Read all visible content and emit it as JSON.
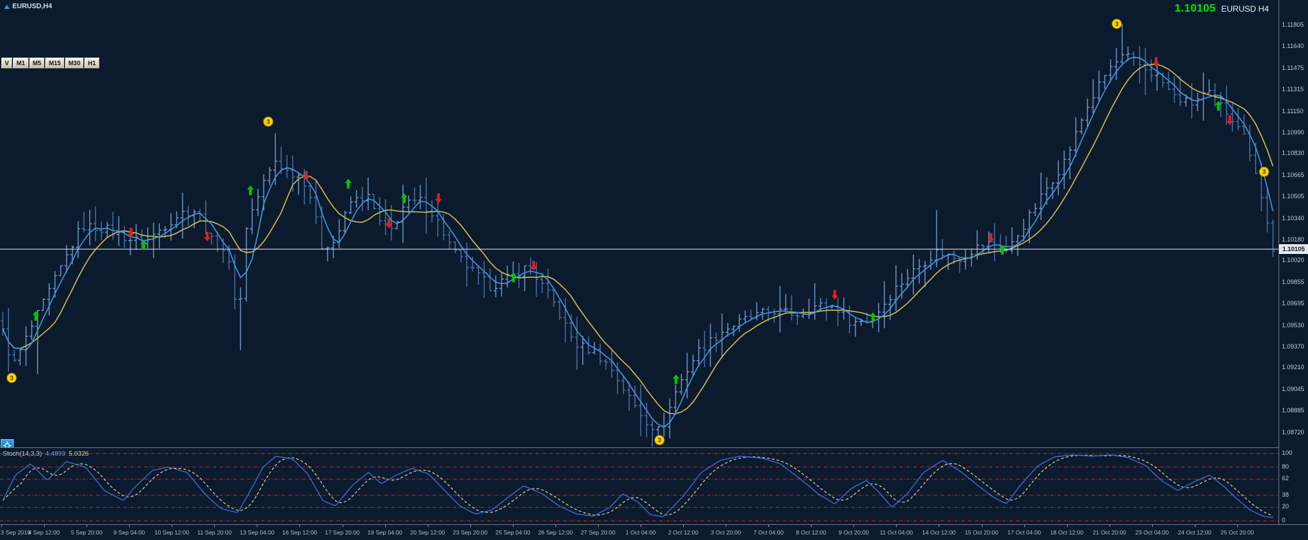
{
  "window": {
    "symbol_label": "EURUSD,H4",
    "quote": "1.10105",
    "quote_symbol": "EURUSD H4"
  },
  "toolbar": {
    "buttons": [
      "V",
      "M1",
      "M5",
      "M15",
      "M30",
      "H1"
    ]
  },
  "price_scale": {
    "current_price": "1.10105"
  },
  "colors": {
    "background": "#0b1a2c",
    "bar_up": "#6f97cf",
    "bar_down": "#4a72ab",
    "ma_fast": "#3f96e0",
    "ma_slow": "#cdb94f",
    "buy_arrow": "#00c800",
    "sell_arrow": "#e01f1f",
    "marker_fill": "#ffd400",
    "marker_stroke": "#8a6d00",
    "quote_green": "#00e600",
    "price_line": "#e6e9ee",
    "stoch_main": "#4066c8",
    "stoch_signal": "#d8d0ae",
    "level_red": "#b03030",
    "axis_text": "#b6bcc6"
  },
  "chart_data": [
    {
      "name": "price-chart",
      "type": "ohlc",
      "symbol": "EURUSD",
      "timeframe": "H4",
      "title": "EURUSD H4",
      "current_price": 1.10105,
      "price_range": {
        "max": 1.1199,
        "min": 1.0861
      },
      "bars_count": 220,
      "y_ticks": [
        "1.11805",
        "1.11640",
        "1.11475",
        "1.11315",
        "1.11150",
        "1.10990",
        "1.10830",
        "1.10665",
        "1.10505",
        "1.10340",
        "1.10180",
        "1.10020",
        "1.09855",
        "1.09695",
        "1.09530",
        "1.09370",
        "1.09210",
        "1.09045",
        "1.08885",
        "1.08720"
      ],
      "x_labels": [
        "3 Sep 2019",
        "4 Sep 12:00",
        "5 Sep 20:00",
        "9 Sep 04:00",
        "10 Sep 12:00",
        "11 Sep 20:00",
        "13 Sep 04:00",
        "16 Sep 12:00",
        "17 Sep 20:00",
        "19 Sep 04:00",
        "20 Sep 12:00",
        "23 Sep 20:00",
        "25 Sep 04:00",
        "26 Sep 12:00",
        "27 Sep 20:00",
        "1 Oct 04:00",
        "2 Oct 12:00",
        "3 Oct 20:00",
        "7 Oct 04:00",
        "8 Oct 12:00",
        "9 Oct 20:00",
        "11 Oct 04:00",
        "14 Oct 12:00",
        "15 Oct 20:00",
        "17 Oct 04:00",
        "18 Oct 12:00",
        "21 Oct 20:00",
        "23 Oct 04:00",
        "24 Oct 12:00",
        "25 Oct 20:00"
      ],
      "close_path": [
        [
          0.0,
          1.0948
        ],
        [
          0.008,
          1.0922
        ],
        [
          0.026,
          1.0958
        ],
        [
          0.062,
          1.1028
        ],
        [
          0.081,
          1.1026
        ],
        [
          0.1,
          1.1018
        ],
        [
          0.112,
          1.1016
        ],
        [
          0.14,
          1.1038
        ],
        [
          0.153,
          1.104
        ],
        [
          0.164,
          1.1017
        ],
        [
          0.176,
          1.1009
        ],
        [
          0.186,
          1.0958
        ],
        [
          0.192,
          1.103
        ],
        [
          0.206,
          1.1062
        ],
        [
          0.215,
          1.1078
        ],
        [
          0.222,
          1.107
        ],
        [
          0.235,
          1.1066
        ],
        [
          0.241,
          1.1055
        ],
        [
          0.251,
          1.1013
        ],
        [
          0.261,
          1.1016
        ],
        [
          0.274,
          1.1046
        ],
        [
          0.287,
          1.1051
        ],
        [
          0.298,
          1.1028
        ],
        [
          0.306,
          1.1025
        ],
        [
          0.316,
          1.1044
        ],
        [
          0.329,
          1.1047
        ],
        [
          0.34,
          1.1036
        ],
        [
          0.355,
          1.1008
        ],
        [
          0.368,
          1.0995
        ],
        [
          0.384,
          1.0982
        ],
        [
          0.401,
          1.099
        ],
        [
          0.414,
          1.0998
        ],
        [
          0.433,
          1.0971
        ],
        [
          0.45,
          1.0939
        ],
        [
          0.466,
          1.0933
        ],
        [
          0.479,
          1.092
        ],
        [
          0.495,
          1.0895
        ],
        [
          0.508,
          1.0879
        ],
        [
          0.518,
          1.0872
        ],
        [
          0.531,
          1.0906
        ],
        [
          0.547,
          1.0933
        ],
        [
          0.567,
          1.0949
        ],
        [
          0.586,
          1.0958
        ],
        [
          0.606,
          1.0964
        ],
        [
          0.625,
          1.0961
        ],
        [
          0.641,
          1.0968
        ],
        [
          0.656,
          1.0967
        ],
        [
          0.668,
          1.0955
        ],
        [
          0.684,
          1.0957
        ],
        [
          0.703,
          1.0981
        ],
        [
          0.72,
          1.0997
        ],
        [
          0.736,
          1.1009
        ],
        [
          0.752,
          1.1003
        ],
        [
          0.769,
          1.1013
        ],
        [
          0.779,
          1.1015
        ],
        [
          0.791,
          1.1009
        ],
        [
          0.808,
          1.1035
        ],
        [
          0.824,
          1.106
        ],
        [
          0.837,
          1.1079
        ],
        [
          0.853,
          1.1117
        ],
        [
          0.87,
          1.1146
        ],
        [
          0.883,
          1.1157
        ],
        [
          0.896,
          1.1149
        ],
        [
          0.909,
          1.1141
        ],
        [
          0.922,
          1.1126
        ],
        [
          0.935,
          1.112
        ],
        [
          0.948,
          1.1129
        ],
        [
          0.961,
          1.1117
        ],
        [
          0.974,
          1.1104
        ],
        [
          0.985,
          1.1076
        ],
        [
          0.993,
          1.104
        ],
        [
          1.0,
          1.10105
        ]
      ],
      "wick_events": [
        {
          "f": 0.026,
          "low": 1.0916
        },
        {
          "f": 0.186,
          "low": 1.0934
        },
        {
          "f": 0.215,
          "high": 1.1098
        },
        {
          "f": 0.518,
          "low": 1.0867
        },
        {
          "f": 0.736,
          "high": 1.104
        },
        {
          "f": 0.883,
          "high": 1.1181
        }
      ],
      "ma_fast_period": 4,
      "ma_slow_period": 9,
      "signals": {
        "buy": [
          [
            0.026,
            1.096
          ],
          [
            0.111,
            1.1014
          ],
          [
            0.195,
            1.1055
          ],
          [
            0.272,
            1.106
          ],
          [
            0.316,
            1.1049
          ],
          [
            0.402,
            1.0989
          ],
          [
            0.53,
            1.0912
          ],
          [
            0.685,
            1.0959
          ],
          [
            0.787,
            1.101
          ],
          [
            0.957,
            1.1119
          ]
        ],
        "sell": [
          [
            0.101,
            1.1023
          ],
          [
            0.161,
            1.102
          ],
          [
            0.239,
            1.1066
          ],
          [
            0.304,
            1.103
          ],
          [
            0.343,
            1.1049
          ],
          [
            0.418,
            1.0998
          ],
          [
            0.655,
            1.0976
          ],
          [
            0.778,
            1.1019
          ],
          [
            0.908,
            1.1152
          ],
          [
            0.966,
            1.1108
          ]
        ]
      },
      "pattern_markers": [
        {
          "label": "3",
          "f": 0.007,
          "price": 1.0913
        },
        {
          "label": "3",
          "f": 0.209,
          "price": 1.1107
        },
        {
          "label": "3",
          "f": 0.517,
          "price": 1.0866
        },
        {
          "label": "3",
          "f": 0.877,
          "price": 1.1181
        },
        {
          "label": "3",
          "f": 0.993,
          "price": 1.1069
        }
      ]
    },
    {
      "name": "stochastic",
      "type": "line",
      "label": "Stoch(14,3,3)",
      "value_main": "4.4893",
      "value_signal": "5.0326",
      "range": [
        0,
        100
      ],
      "levels": [
        100,
        80,
        62,
        38,
        20,
        0
      ],
      "scale_labels": [
        "100",
        "80",
        "62",
        "38",
        "20",
        "0"
      ],
      "points": [
        [
          0.0,
          30
        ],
        [
          0.01,
          68
        ],
        [
          0.022,
          85
        ],
        [
          0.035,
          60
        ],
        [
          0.05,
          88
        ],
        [
          0.065,
          80
        ],
        [
          0.08,
          45
        ],
        [
          0.095,
          30
        ],
        [
          0.105,
          52
        ],
        [
          0.118,
          75
        ],
        [
          0.13,
          80
        ],
        [
          0.145,
          72
        ],
        [
          0.16,
          38
        ],
        [
          0.172,
          18
        ],
        [
          0.185,
          12
        ],
        [
          0.195,
          45
        ],
        [
          0.205,
          80
        ],
        [
          0.215,
          96
        ],
        [
          0.228,
          92
        ],
        [
          0.24,
          70
        ],
        [
          0.252,
          30
        ],
        [
          0.262,
          22
        ],
        [
          0.275,
          52
        ],
        [
          0.288,
          72
        ],
        [
          0.298,
          55
        ],
        [
          0.31,
          68
        ],
        [
          0.322,
          78
        ],
        [
          0.335,
          70
        ],
        [
          0.348,
          45
        ],
        [
          0.36,
          22
        ],
        [
          0.372,
          10
        ],
        [
          0.385,
          16
        ],
        [
          0.398,
          35
        ],
        [
          0.41,
          52
        ],
        [
          0.425,
          40
        ],
        [
          0.438,
          22
        ],
        [
          0.452,
          10
        ],
        [
          0.465,
          7
        ],
        [
          0.478,
          20
        ],
        [
          0.488,
          40
        ],
        [
          0.5,
          28
        ],
        [
          0.51,
          9
        ],
        [
          0.52,
          6
        ],
        [
          0.535,
          35
        ],
        [
          0.55,
          72
        ],
        [
          0.565,
          90
        ],
        [
          0.58,
          96
        ],
        [
          0.598,
          93
        ],
        [
          0.612,
          85
        ],
        [
          0.628,
          62
        ],
        [
          0.642,
          40
        ],
        [
          0.655,
          25
        ],
        [
          0.668,
          48
        ],
        [
          0.68,
          60
        ],
        [
          0.69,
          42
        ],
        [
          0.7,
          20
        ],
        [
          0.712,
          40
        ],
        [
          0.725,
          72
        ],
        [
          0.74,
          90
        ],
        [
          0.755,
          72
        ],
        [
          0.768,
          52
        ],
        [
          0.78,
          35
        ],
        [
          0.79,
          25
        ],
        [
          0.802,
          55
        ],
        [
          0.815,
          82
        ],
        [
          0.828,
          95
        ],
        [
          0.842,
          98
        ],
        [
          0.858,
          96
        ],
        [
          0.872,
          98
        ],
        [
          0.886,
          94
        ],
        [
          0.9,
          82
        ],
        [
          0.912,
          60
        ],
        [
          0.925,
          45
        ],
        [
          0.938,
          58
        ],
        [
          0.95,
          68
        ],
        [
          0.962,
          50
        ],
        [
          0.972,
          32
        ],
        [
          0.982,
          16
        ],
        [
          0.992,
          7
        ],
        [
          1.0,
          4.5
        ]
      ]
    }
  ]
}
